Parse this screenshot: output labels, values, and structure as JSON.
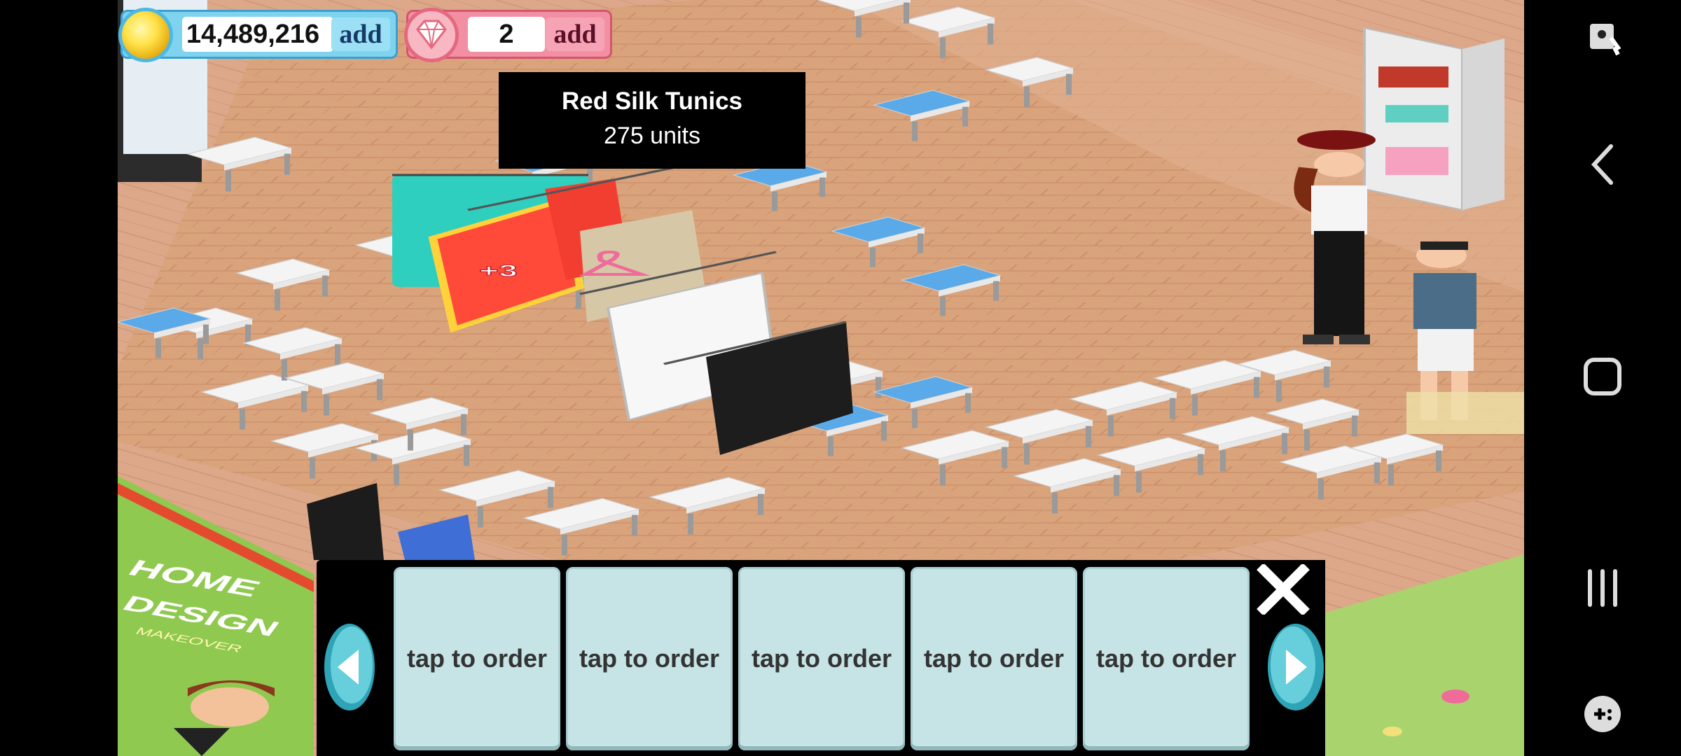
{
  "hud": {
    "coins": "14,489,216",
    "coins_add": "add",
    "gems": "2",
    "gems_add": "add"
  },
  "tooltip": {
    "item_name": "Red Silk Tunics",
    "quantity": "275 units"
  },
  "floating_bonus": "+3",
  "order_panel": {
    "slots": [
      {
        "label": "tap to order"
      },
      {
        "label": "tap to order"
      },
      {
        "label": "tap to order"
      },
      {
        "label": "tap to order"
      },
      {
        "label": "tap to order"
      }
    ]
  },
  "sign": {
    "line1": "HOME",
    "line2": "DESIGN",
    "line3": "MAKEOVER"
  },
  "colors": {
    "floor": "#d8a17a",
    "table_white": "#f2f2f2",
    "table_blue": "#5aa9e8",
    "panel_slot": "#c6e4e6",
    "arrow": "#3fb6c9"
  }
}
